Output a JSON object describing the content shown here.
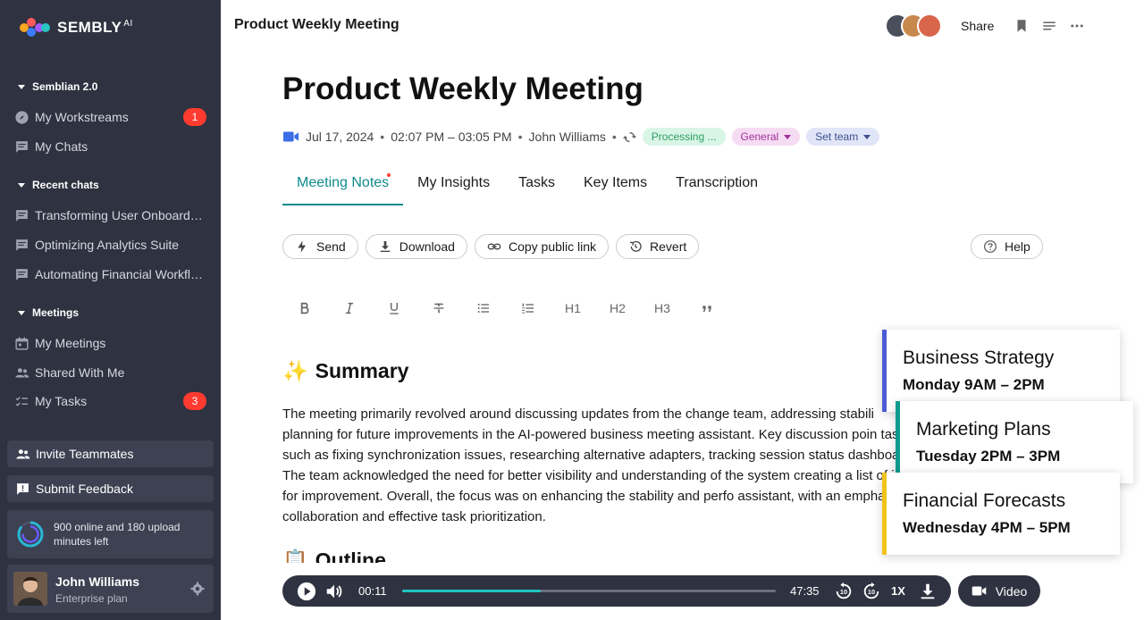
{
  "brand": {
    "name": "SEMBLY",
    "suffix": "AI"
  },
  "sidebar": {
    "semblian": {
      "heading": "Semblian 2.0",
      "items": [
        {
          "label": "My Workstreams",
          "icon": "compass-icon",
          "badge": "1"
        },
        {
          "label": "My Chats",
          "icon": "chat-icon"
        }
      ]
    },
    "recent": {
      "heading": "Recent chats",
      "items": [
        {
          "label": "Transforming User Onboarding"
        },
        {
          "label": "Optimizing Analytics Suite"
        },
        {
          "label": "Automating Financial Workflo..."
        }
      ]
    },
    "meetings": {
      "heading": "Meetings",
      "items": [
        {
          "label": "My Meetings",
          "icon": "calendar-icon"
        },
        {
          "label": "Shared With Me",
          "icon": "people-icon"
        },
        {
          "label": "My Tasks",
          "icon": "checklist-icon",
          "badge": "3"
        }
      ]
    },
    "invite": "Invite Teammates",
    "feedback": "Submit Feedback",
    "usage": "900 online and 180 upload minutes left",
    "user": {
      "name": "John Williams",
      "plan": "Enterprise plan"
    }
  },
  "header": {
    "title": "Product Weekly Meeting",
    "share": "Share"
  },
  "meeting": {
    "title": "Product Weekly Meeting",
    "date": "Jul 17, 2024",
    "time": "02:07 PM – 03:05 PM",
    "owner": "John Williams",
    "status": "Processing ...",
    "category": "General",
    "team": "Set team",
    "colors": {
      "status_bg": "#d9f5e6",
      "status_fg": "#2e9e63",
      "category_bg": "#f6dcf3",
      "category_fg": "#a0309a",
      "team_bg": "#e0e5f7",
      "team_fg": "#3d4f8f"
    }
  },
  "tabs": [
    {
      "label": "Meeting Notes",
      "active": true
    },
    {
      "label": "My Insights"
    },
    {
      "label": "Tasks"
    },
    {
      "label": "Key Items"
    },
    {
      "label": "Transcription"
    }
  ],
  "actions": {
    "send": "Send",
    "download": "Download",
    "copy": "Copy public link",
    "revert": "Revert",
    "help": "Help"
  },
  "format_toolbar": {
    "h1": "H1",
    "h2": "H2",
    "h3": "H3"
  },
  "content": {
    "summary_emoji": "✨",
    "summary_heading": "Summary",
    "summary_text": "The meeting primarily revolved around discussing updates from the change team, addressing stabili planning for future improvements in the AI-powered business meeting assistant. Key discussion poin tasks such as fixing synchronization issues, researching alternative adapters, tracking session status dashboards. The team acknowledged the need for better visibility and understanding of the system creating a list of ideas for improvement. Overall, the focus was on enhancing the stability and perfo assistant, with an emphasis on collaboration and effective task prioritization.",
    "outline_emoji": "📋",
    "outline_heading": "Outline"
  },
  "cards": [
    {
      "title": "Business Strategy",
      "subtitle": "Monday 9AM – 2PM",
      "color": "#4a5bd4"
    },
    {
      "title": "Marketing Plans",
      "subtitle": "Tuesday 2PM – 3PM",
      "color": "#0f9a8e"
    },
    {
      "title": "Financial Forecasts",
      "subtitle": "Wednesday 4PM – 5PM",
      "color": "#f2c318"
    }
  ],
  "player": {
    "current": "00:11",
    "duration": "47:35",
    "speed": "1X",
    "progress": 0.37,
    "video": "Video"
  }
}
